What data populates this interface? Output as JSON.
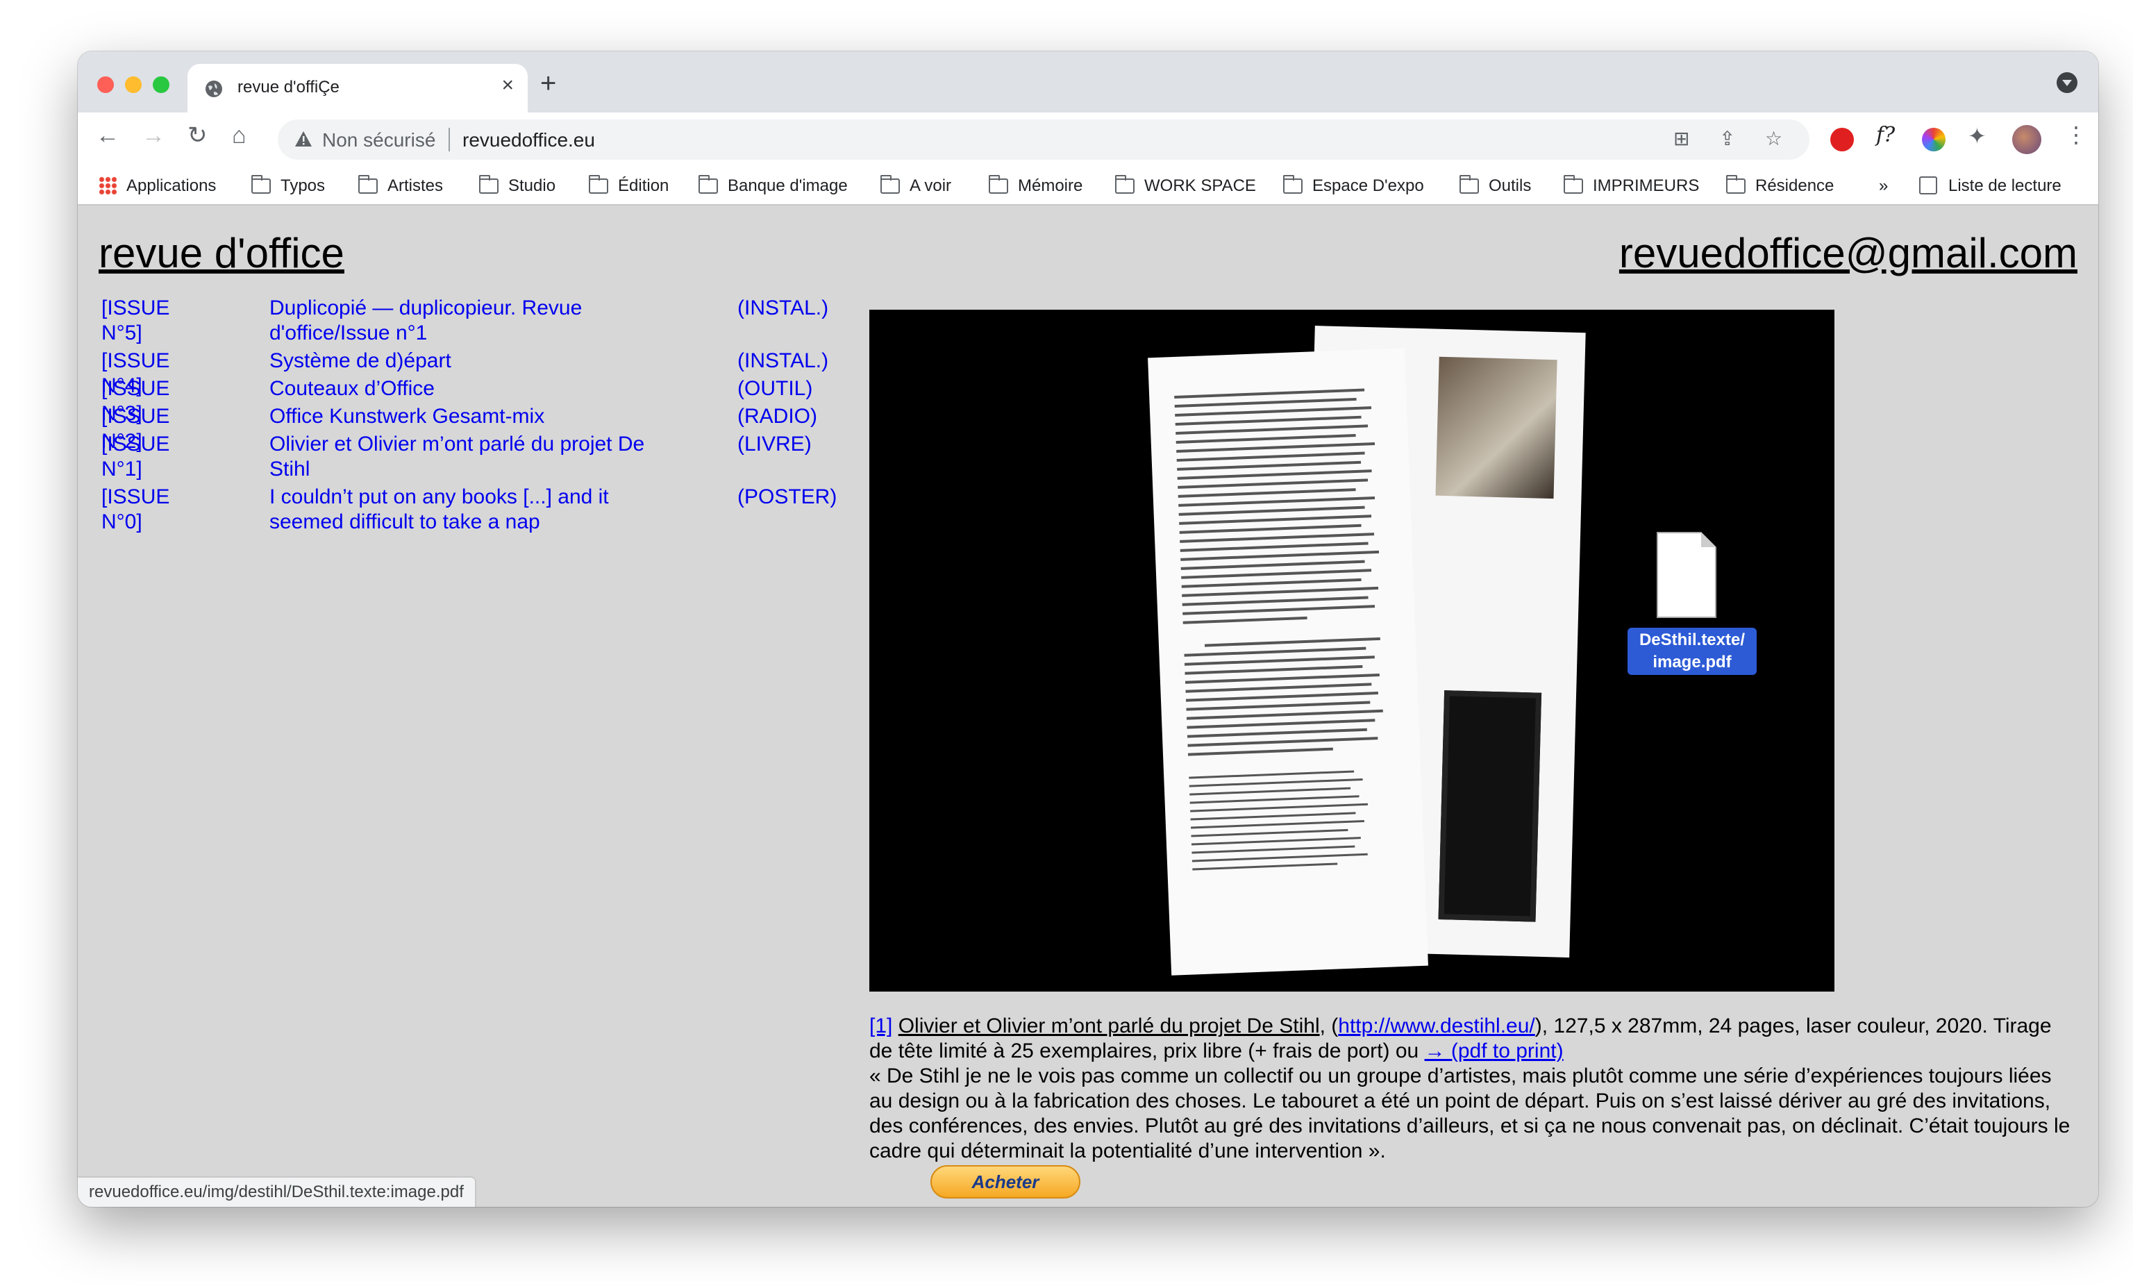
{
  "tab": {
    "title": "revue d'offiÇe",
    "new_tab_label": "+"
  },
  "toolbar": {
    "security_label": "Non sécurisé",
    "url": "revuedoffice.eu"
  },
  "bookmarks": {
    "apps": "Applications",
    "items": [
      "Typos",
      "Artistes",
      "Studio",
      "Édition",
      "Banque d'image",
      "A voir",
      "Mémoire",
      "WORK SPACE",
      "Espace D'expo",
      "Outils",
      "IMPRIMEURS",
      "Résidence"
    ],
    "overflow": "»",
    "reading_list": "Liste de lecture"
  },
  "site": {
    "title": "revue d'office",
    "email": "revuedoffice@gmail.com"
  },
  "issues": [
    {
      "num": "[ISSUE N°5]",
      "title": "Duplicopié — duplicopieur. Revue d'office/Issue n°1",
      "type": "(INSTAL.)"
    },
    {
      "num": "[ISSUE N°4]",
      "title": "Système de d)épart",
      "type": "(INSTAL.)"
    },
    {
      "num": "[ISSUE N°3]",
      "title": "Couteaux d’Office",
      "type": "(OUTIL)"
    },
    {
      "num": "[ISSUE N°2]",
      "title": "Office Kunstwerk Gesamt-mix",
      "type": "(RADIO)"
    },
    {
      "num": "[ISSUE N°1]",
      "title": "Olivier et Olivier m’ont parlé du projet De Stihl",
      "type": "(LIVRE)"
    },
    {
      "num": "[ISSUE N°0]",
      "title": "I couldn’t put on any books [...] and it seemed difficult to take a nap",
      "type": "(POSTER)"
    }
  ],
  "file_icon": {
    "label_line1": "DeSthil.texte/",
    "label_line2": "image.pdf"
  },
  "caption": {
    "ref": "[1]",
    "title": "Olivier et Olivier m’ont parlé du projet De Stihl",
    "link_open": ", (",
    "link": "http://www.destihl.eu/",
    "details": "), 127,5 x 287mm, 24 pages, laser couleur, 2020. Tirage de tête limité à 25 exemplaires, prix libre (+ frais de port) ou ",
    "pdf_link": "→ (pdf to print)",
    "quote": "« De Stihl je ne le vois pas comme un collectif ou un groupe d’artistes, mais plutôt comme une série d’expériences toujours liées au design ou à la fabrication des choses. Le tabouret a été un point de départ. Puis on s’est laissé dériver au gré des invitations, des conférences, des envies. Plutôt au gré des invitations d’ailleurs, et si ça ne nous convenait pas, on déclinait. C’était toujours le cadre qui déterminait la potentialité d’une intervention »."
  },
  "buy_button": "Acheter",
  "status_url": "revuedoffice.eu/img/destihl/DeSthil.texte:image.pdf"
}
